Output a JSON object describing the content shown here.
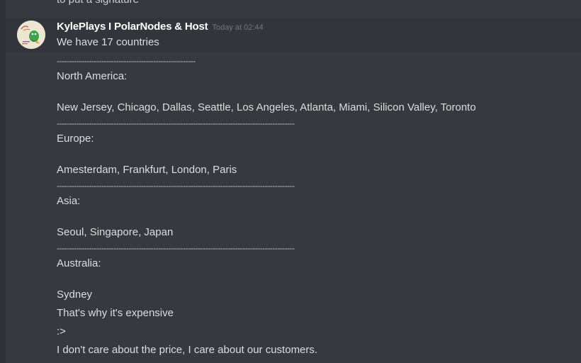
{
  "previous_message": {
    "partial_text": "to put a signature"
  },
  "message": {
    "author": "KylePlays I PolarNodes & Host",
    "timestamp": "Today at 02:44",
    "lines": {
      "intro": "We have 17 countries",
      "divider_short": "--------------------------------------------------------",
      "na_heading": "North America:",
      "na_cities": "New Jersey, Chicago, Dallas, Seattle, Los Angeles, Atlanta, Miami, Silicon Valley, Toronto",
      "divider_long_1": "------------------------------------------------------------------------------------------------",
      "eu_heading": "Europe:",
      "eu_cities": "Amesterdam, Frankfurt, London, Paris",
      "divider_long_2": "------------------------------------------------------------------------------------------------",
      "asia_heading": "Asia:",
      "asia_cities": "Seoul, Singapore, Japan",
      "divider_long_3": "------------------------------------------------------------------------------------------------",
      "au_heading": "Australia:",
      "au_cities": "Sydney",
      "expensive": "That's why it's expensive",
      "emote": ":>",
      "care": "I don't care about the price, I care about our customers."
    }
  },
  "colors": {
    "background": "#36393f",
    "hover": "#32353b",
    "text": "#dcddde",
    "author": "#ffffff",
    "timestamp": "#72767d"
  }
}
